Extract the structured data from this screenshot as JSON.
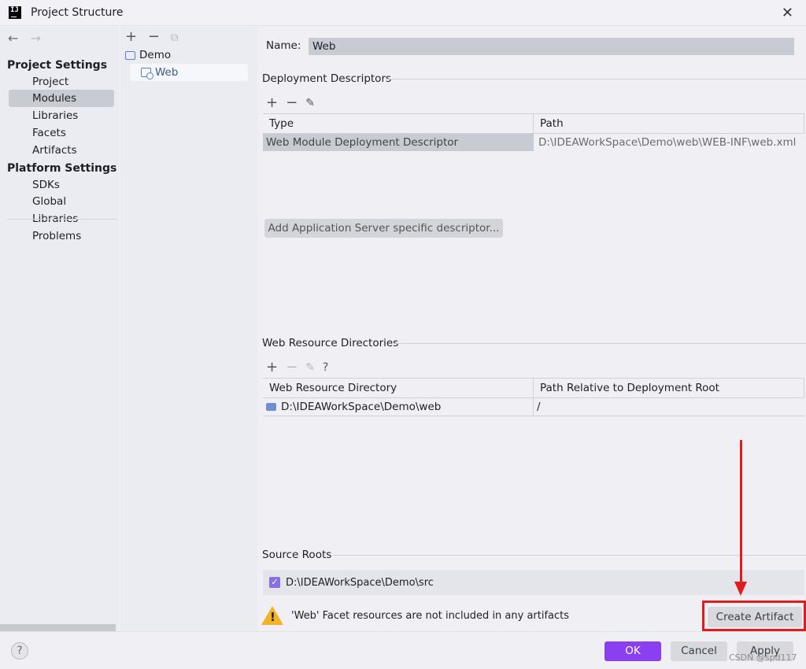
{
  "window": {
    "title": "Project Structure",
    "app_icon": "IJ"
  },
  "nav": {
    "back": "←",
    "forward": "→",
    "project_settings_heading": "Project Settings",
    "project_items": [
      "Project",
      "Modules",
      "Libraries",
      "Facets",
      "Artifacts"
    ],
    "platform_settings_heading": "Platform Settings",
    "platform_items": [
      "SDKs",
      "Global Libraries"
    ],
    "problems": "Problems"
  },
  "tree": {
    "tools": {
      "add": "+",
      "remove": "−",
      "copy": "⧉"
    },
    "nodes": [
      {
        "label": "Demo",
        "icon": "module-folder-icon"
      },
      {
        "label": "Web",
        "icon": "web-facet-icon"
      }
    ]
  },
  "facet": {
    "name_label": "Name:",
    "name_value": "Web",
    "deployment": {
      "title": "Deployment Descriptors",
      "tools": {
        "add": "+",
        "remove": "−",
        "edit": "✎"
      },
      "columns": [
        "Type",
        "Path"
      ],
      "rows": [
        {
          "type": "Web Module Deployment Descriptor",
          "path": "D:\\IDEAWorkSpace\\Demo\\web\\WEB-INF\\web.xml"
        }
      ],
      "add_button": "Add Application Server specific descriptor..."
    },
    "web_resources": {
      "title": "Web Resource Directories",
      "tools": {
        "add": "+",
        "remove": "−",
        "edit": "✎",
        "help": "?"
      },
      "columns": [
        "Web Resource Directory",
        "Path Relative to Deployment Root"
      ],
      "rows": [
        {
          "dir": "D:\\IDEAWorkSpace\\Demo\\web",
          "relative": "/"
        }
      ]
    },
    "source_roots": {
      "title": "Source Roots",
      "items": [
        {
          "checked": true,
          "path": "D:\\IDEAWorkSpace\\Demo\\src"
        }
      ]
    },
    "warning": "'Web' Facet resources are not included in any artifacts",
    "create_artifact": "Create Artifact"
  },
  "footer": {
    "help": "?",
    "ok": "OK",
    "cancel": "Cancel",
    "apply": "Apply",
    "watermark": "CSDN @spd117"
  },
  "colors": {
    "accent": "#8a40f0",
    "annotation_red": "#e21c1c",
    "warning": "#f2b328"
  }
}
